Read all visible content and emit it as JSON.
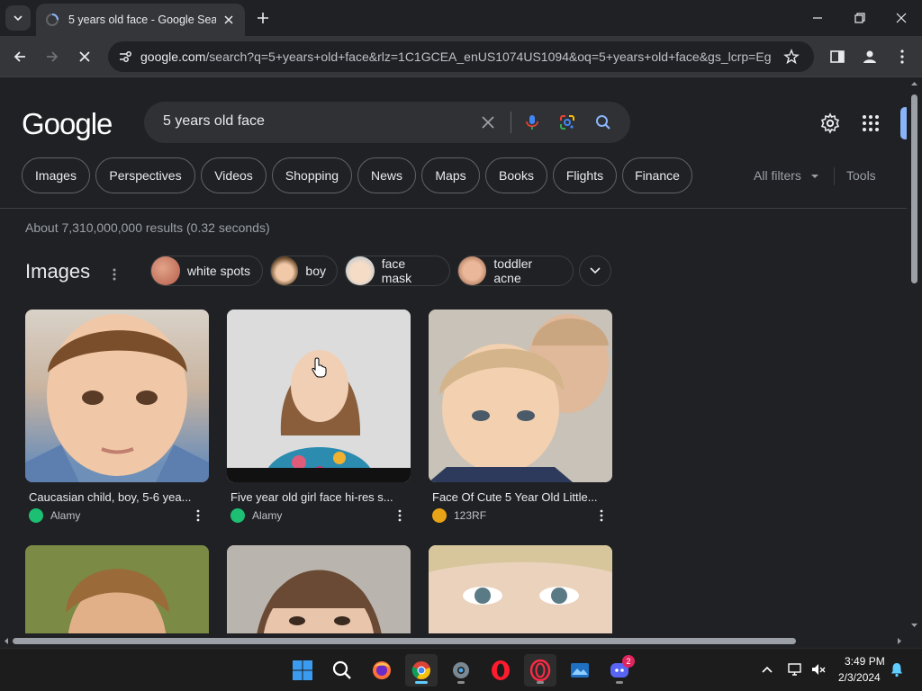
{
  "browser": {
    "tab_title": "5 years old face - Google Search",
    "url_host": "google.com",
    "url_path": "/search?q=5+years+old+face&rlz=1C1GCEA_enUS1074US1094&oq=5+years+old+face&gs_lcrp=Eg..."
  },
  "search": {
    "logo": "Google",
    "query": "5 years old face"
  },
  "filter_chips": [
    "Images",
    "Perspectives",
    "Videos",
    "Shopping",
    "News",
    "Maps",
    "Books",
    "Flights",
    "Finance"
  ],
  "filters": {
    "all_filters": "All filters",
    "tools": "Tools"
  },
  "result_stats": "About 7,310,000,000 results (0.32 seconds)",
  "images_section": {
    "heading": "Images",
    "refine_chips": [
      "white spots",
      "boy",
      "face mask",
      "toddler acne"
    ],
    "results": [
      {
        "title": "Caucasian child, boy, 5-6 yea...",
        "source": "Alamy",
        "source_color": "#1dbf73"
      },
      {
        "title": "Five year old girl face hi-res s...",
        "source": "Alamy",
        "source_color": "#1dbf73"
      },
      {
        "title": "Face Of Cute 5 Year Old Little...",
        "source": "123RF",
        "source_color": "#e8a317"
      }
    ]
  },
  "taskbar": {
    "time": "3:49 PM",
    "date": "2/3/2024",
    "discord_badge": "2"
  },
  "colors": {
    "page_bg": "#202124",
    "toolbar_bg": "#35363a",
    "chip_border": "#5f6368",
    "accent_blue": "#8ab4f8"
  }
}
